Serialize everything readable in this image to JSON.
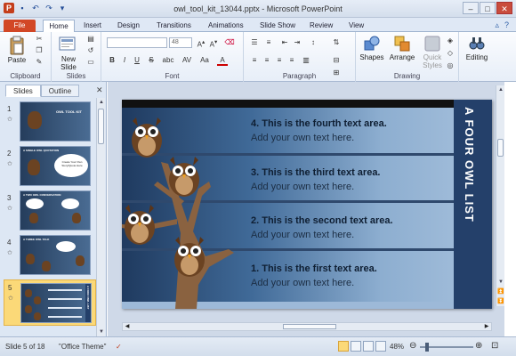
{
  "window": {
    "title": "owl_tool_kit_13044.pptx - Microsoft PowerPoint"
  },
  "ribbon_tabs": [
    "File",
    "Home",
    "Insert",
    "Design",
    "Transitions",
    "Animations",
    "Slide Show",
    "Review",
    "View"
  ],
  "ribbon": {
    "clipboard": {
      "label": "Clipboard",
      "paste": "Paste"
    },
    "slides": {
      "label": "Slides",
      "new_slide": "New Slide"
    },
    "font": {
      "label": "Font",
      "size": "48",
      "bold": "B",
      "italic": "I",
      "underline": "U",
      "strike": "S",
      "shadow": "abc",
      "spacing": "AV",
      "case": "Aa",
      "color": "A"
    },
    "paragraph": {
      "label": "Paragraph"
    },
    "drawing": {
      "label": "Drawing",
      "shapes": "Shapes",
      "arrange": "Arrange",
      "quick_styles": "Quick Styles"
    },
    "editing": {
      "label": "Editing"
    }
  },
  "left_panel": {
    "tabs": [
      "Slides",
      "Outline"
    ],
    "thumbnails": [
      {
        "num": "1",
        "title": "OWL TOOL KIT"
      },
      {
        "num": "2",
        "title": "A SINGLE OWL QUOTATION",
        "bubble": "Create Your Own Story/Quote Here"
      },
      {
        "num": "3",
        "title": "A TWO OWL CONVERSATION"
      },
      {
        "num": "4",
        "title": "A THREE OWL TALK"
      },
      {
        "num": "5",
        "title": "A FOUR OWL LIST"
      }
    ]
  },
  "slide": {
    "title": "A FOUR OWL LIST",
    "items": [
      {
        "heading": "4. This is the fourth text area.",
        "sub": "Add your own text here."
      },
      {
        "heading": "3. This is the third text area.",
        "sub": "Add your own text here."
      },
      {
        "heading": "2. This is the second text area.",
        "sub": "Add your own text here."
      },
      {
        "heading": "1. This is the first text area.",
        "sub": "Add your own text here."
      }
    ]
  },
  "status": {
    "slide": "Slide 5 of 18",
    "theme": "\"Office Theme\"",
    "zoom": "48%"
  },
  "colors": {
    "accent": "#d24726",
    "slide_dark": "#1f3a5f",
    "slide_light": "#a7c1dd",
    "sidebar": "#24406a",
    "selection": "#fbd978"
  },
  "icons": [
    "save-icon",
    "undo-icon",
    "redo-icon",
    "cut-icon",
    "copy-icon",
    "format-painter-icon",
    "help-icon",
    "minimize-icon",
    "maximize-icon",
    "close-icon"
  ]
}
